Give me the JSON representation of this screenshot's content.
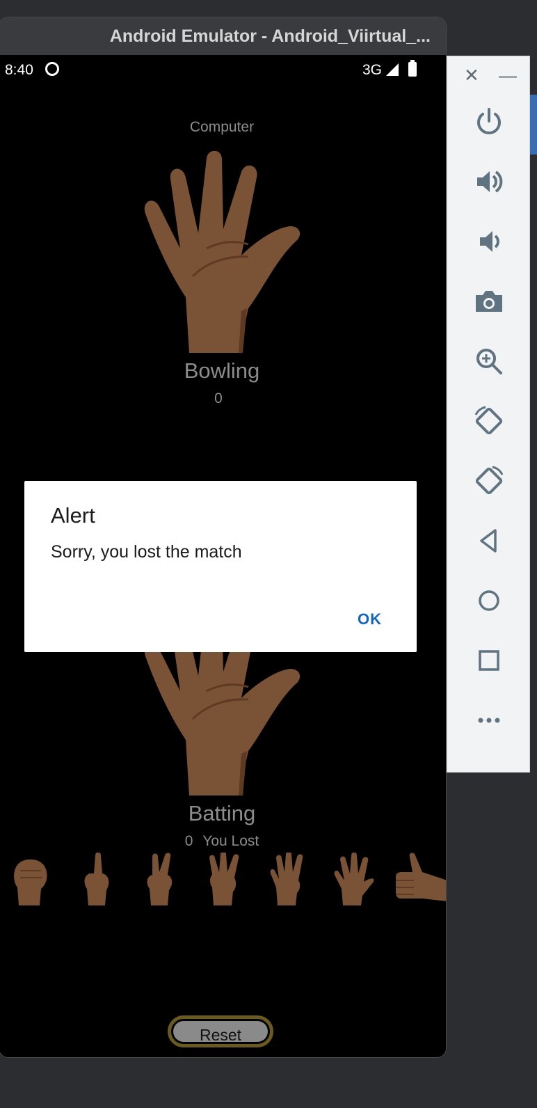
{
  "window": {
    "title": "Android Emulator - Android_Viirtual_..."
  },
  "status_bar": {
    "time": "8:40",
    "network": "3G"
  },
  "game": {
    "computer_label": "Computer",
    "bowling_label": "Bowling",
    "bowling_score": "0",
    "batting_label": "Batting",
    "batting_score": "0",
    "batting_status": "You Lost",
    "finger_options": [
      "fist",
      "one-finger",
      "two-fingers",
      "three-fingers",
      "four-fingers",
      "five-fingers",
      "thumbs-up"
    ],
    "reset_label": "Reset"
  },
  "dialog": {
    "title": "Alert",
    "message": "Sorry, you lost the match",
    "ok_label": "OK"
  },
  "sidebar": {
    "tools": [
      "power-icon",
      "volume-up-icon",
      "volume-down-icon",
      "camera-icon",
      "zoom-icon",
      "rotate-left-icon",
      "rotate-right-icon",
      "back-icon",
      "home-icon",
      "overview-icon",
      "more-icon"
    ]
  },
  "colors": {
    "skin": "#7a5235",
    "skin_dark": "#5e3a22",
    "dialog_button": "#1565c0",
    "reset_border": "#6b5a1f"
  }
}
